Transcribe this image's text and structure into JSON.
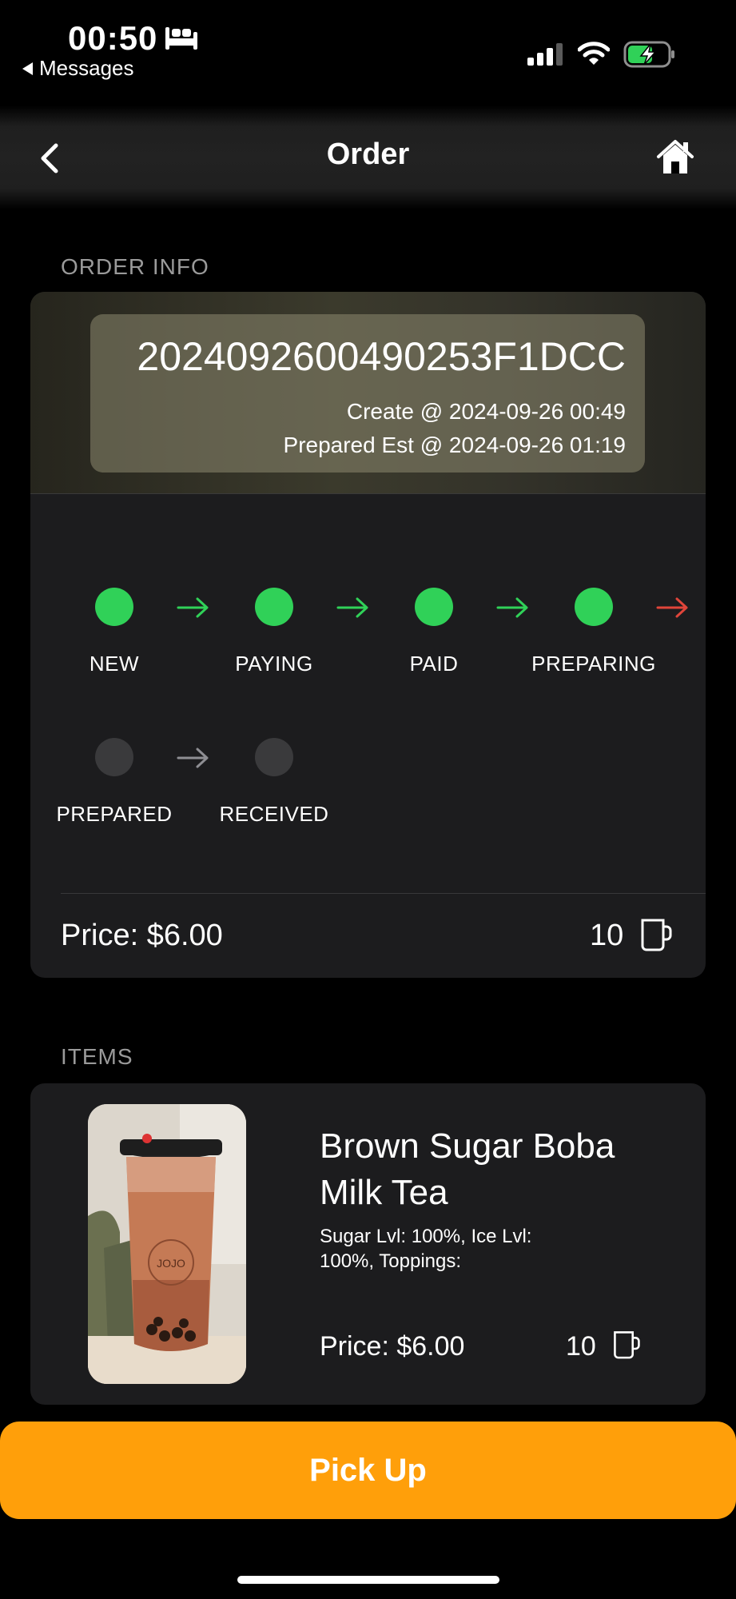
{
  "status_bar": {
    "time": "00:50",
    "back_app": "Messages",
    "icons": [
      "bed-icon",
      "signal-icon",
      "wifi-icon",
      "battery-charging-icon"
    ]
  },
  "nav": {
    "title": "Order",
    "back_icon": "chevron-left-icon",
    "home_icon": "home-icon"
  },
  "order_info": {
    "section_label": "ORDER INFO",
    "order_id": "2024092600490253F1DCC",
    "created": "Create @ 2024-09-26 00:49",
    "prepared_est": "Prepared Est @ 2024-09-26 01:19",
    "steps": [
      {
        "label": "NEW",
        "done": true
      },
      {
        "label": "PAYING",
        "done": true
      },
      {
        "label": "PAID",
        "done": true
      },
      {
        "label": "PREPARING",
        "done": true
      },
      {
        "label": "PREPARED",
        "done": false
      },
      {
        "label": "RECEIVED",
        "done": false
      }
    ],
    "price": "Price: $6.00",
    "count": "10"
  },
  "items": {
    "section_label": "ITEMS",
    "list": [
      {
        "name": "Brown Sugar Boba Milk Tea",
        "description": "Sugar Lvl: 100%, Ice Lvl: 100%, Toppings:",
        "price": "Price: $6.00",
        "count": "10",
        "image_text": "JOJO"
      }
    ]
  },
  "actions": {
    "pickup_label": "Pick Up"
  },
  "colors": {
    "done": "#30d158",
    "pending": "#3a3a3c",
    "current_arrow": "#e0453a",
    "accent": "#ff9f0a"
  }
}
